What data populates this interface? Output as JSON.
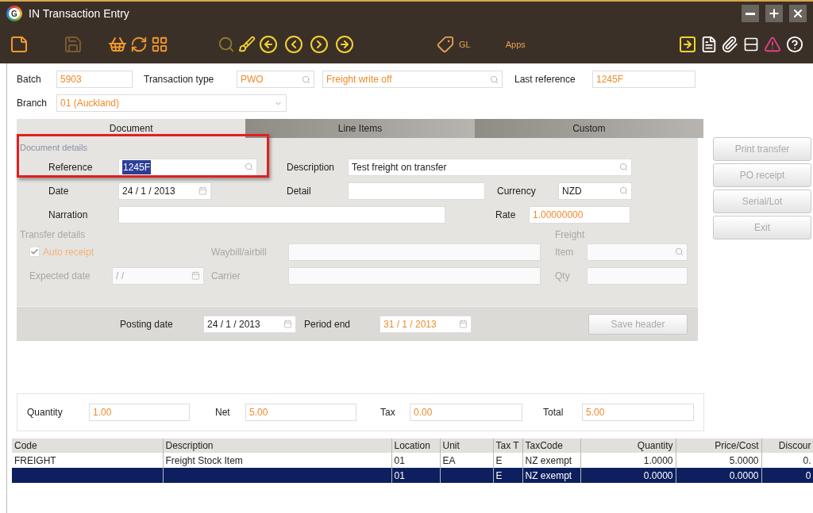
{
  "window": {
    "logo_letter": "G",
    "title": "IN Transaction Entry"
  },
  "toolbar": {
    "gl_label": "GL",
    "apps_label": "Apps"
  },
  "header": {
    "batch": {
      "label": "Batch",
      "value": "5903"
    },
    "transaction_type": {
      "label": "Transaction type",
      "code": "PWO",
      "name": "Freight write off"
    },
    "last_reference": {
      "label": "Last reference",
      "value": "1245F"
    },
    "branch": {
      "label": "Branch",
      "value": "01 (Auckland)"
    }
  },
  "tabs": [
    {
      "label": "Document",
      "selected": true
    },
    {
      "label": "Line Items",
      "selected": false
    },
    {
      "label": "Custom",
      "selected": false
    }
  ],
  "document_details": {
    "heading": "Document details",
    "reference": {
      "label": "Reference",
      "value": "1245F",
      "text_selected": true
    },
    "description": {
      "label": "Description",
      "value": "Test freight on transfer"
    },
    "date": {
      "label": "Date",
      "value": "24 / 1 / 2013"
    },
    "detail": {
      "label": "Detail"
    },
    "currency": {
      "label": "Currency",
      "value": "NZD"
    },
    "narration": {
      "label": "Narration"
    },
    "rate": {
      "label": "Rate",
      "value": "1.00000000"
    }
  },
  "transfer_details": {
    "heading": "Transfer details",
    "disabled": true,
    "auto_receipt": {
      "label": "Auto receipt",
      "checked": true
    },
    "waybill": {
      "label": "Waybill/airbill"
    },
    "freight_heading": "Freight",
    "item": {
      "label": "Item"
    },
    "expected_date": {
      "label": "Expected date",
      "value": "/   /"
    },
    "carrier": {
      "label": "Carrier"
    },
    "qty": {
      "label": "Qty"
    }
  },
  "posting": {
    "posting_date": {
      "label": "Posting date",
      "value": "24 / 1 / 2013"
    },
    "period_end": {
      "label": "Period end",
      "value": "31 / 1 / 2013"
    },
    "save_button": {
      "label": "Save header",
      "disabled": true
    }
  },
  "side_buttons": [
    {
      "label": "Print transfer",
      "disabled": true
    },
    {
      "label": "PO receipt",
      "disabled": true
    },
    {
      "label": "Serial/Lot",
      "disabled": true
    },
    {
      "label": "Exit",
      "disabled": true
    }
  ],
  "totals": [
    {
      "label": "Quantity",
      "value": "1.00"
    },
    {
      "label": "Net",
      "value": "5.00"
    },
    {
      "label": "Tax",
      "value": "0.00"
    },
    {
      "label": "Total",
      "value": "5.00"
    }
  ],
  "grid": {
    "columns": [
      "Code",
      "Description",
      "Location",
      "Unit",
      "Tax T",
      "TaxCode",
      "Quantity",
      "Price/Cost",
      "Discour"
    ],
    "rows": [
      {
        "cells": [
          "FREIGHT",
          "Freight Stock Item",
          "01",
          "EA",
          "E",
          "NZ exempt",
          "1.0000",
          "5.0000",
          "0."
        ],
        "selected": false
      },
      {
        "cells": [
          "",
          "",
          "01",
          "",
          "E",
          "NZ exempt",
          "0.0000",
          "0.0000",
          "0"
        ],
        "selected": true
      }
    ]
  }
}
